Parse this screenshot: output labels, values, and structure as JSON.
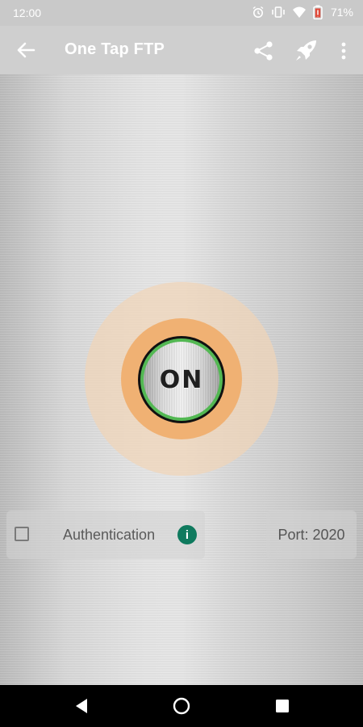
{
  "status_bar": {
    "time": "12:00",
    "battery_percent": "71%",
    "icons": [
      "alarm-icon",
      "vibrate-icon",
      "wifi-icon",
      "battery-icon"
    ]
  },
  "app_bar": {
    "title": "One Tap FTP",
    "back_icon": "arrow-back-icon",
    "actions": [
      "share-icon",
      "rocket-icon",
      "more-vert-icon"
    ]
  },
  "power_button": {
    "label": "ON",
    "state": "on",
    "colors": {
      "halo": "#f1d4b6",
      "ring": "#f0b173",
      "indicator_green": "#53b853"
    }
  },
  "settings": {
    "authentication": {
      "label": "Authentication",
      "checked": false,
      "info_glyph": "i",
      "info_color": "#0f7a5e"
    },
    "port": {
      "label": "Port: 2020"
    }
  },
  "nav_bar": {
    "buttons": [
      "nav-back-icon",
      "nav-home-icon",
      "nav-recents-icon"
    ]
  }
}
